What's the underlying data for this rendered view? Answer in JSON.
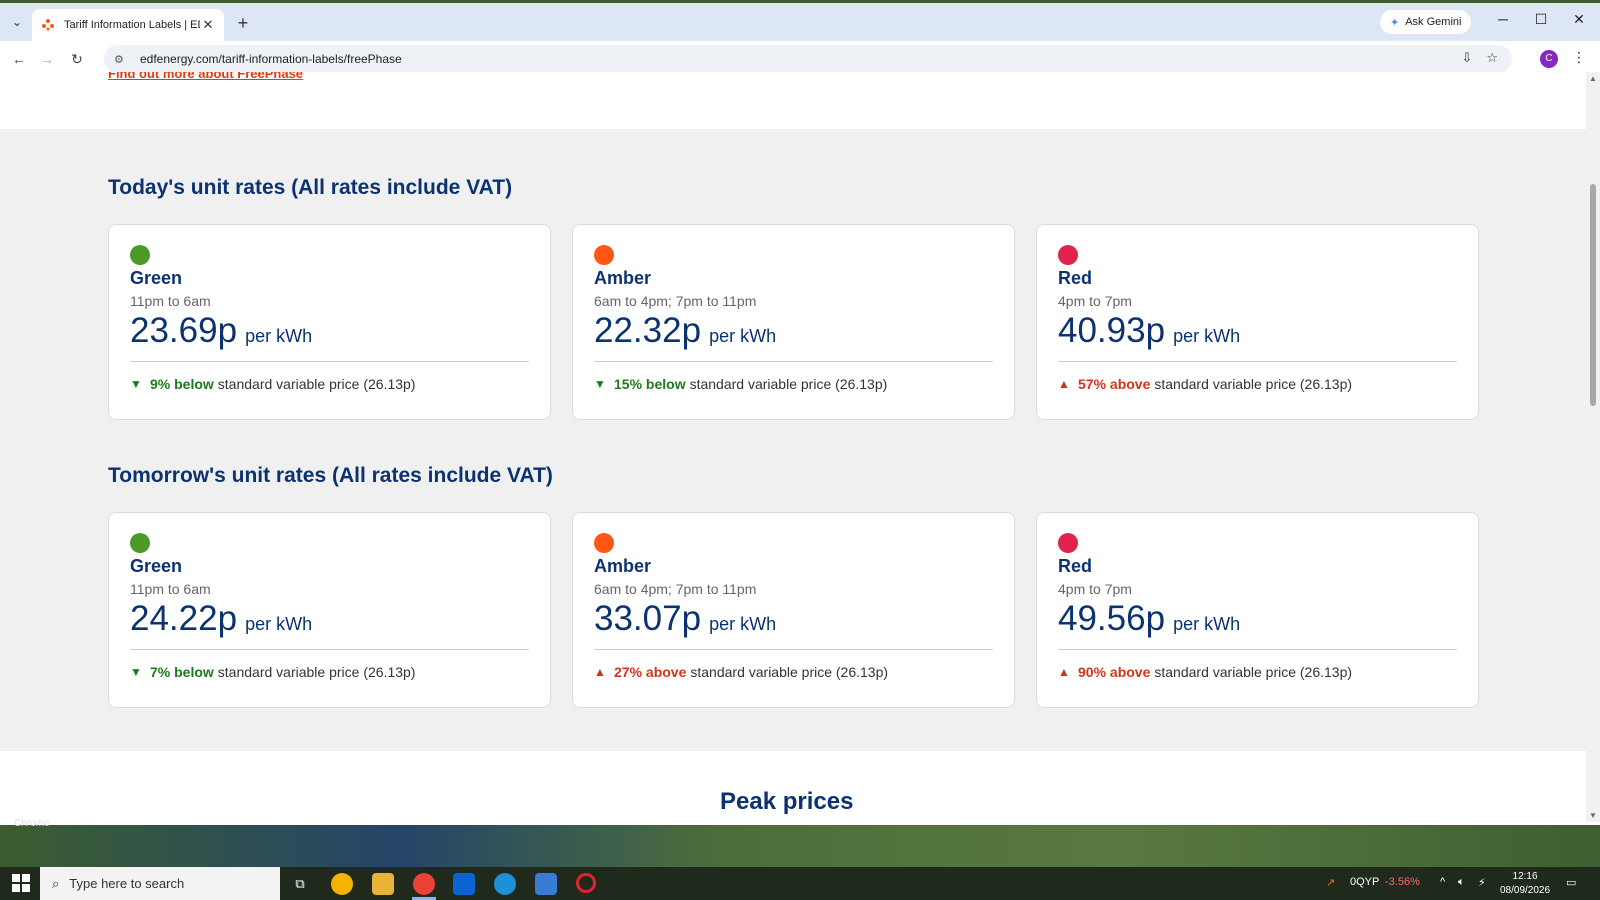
{
  "browser": {
    "tab_title": "Tariff Information Labels | EDF",
    "url": "edfenergy.com/tariff-information-labels/freePhase",
    "ask_gemini": "Ask Gemini",
    "avatar_letter": "C"
  },
  "page": {
    "find_more_link": "Find out more about FreePhase",
    "today_title": "Today's unit rates (All rates include VAT)",
    "tomorrow_title": "Tomorrow's unit rates (All rates include VAT)",
    "next_heading": "Peak prices",
    "per_kwh": "per kWh",
    "svp_text": "standard variable price (26.13p)",
    "today": [
      {
        "name": "Green",
        "time": "11pm to 6am",
        "price": "23.69p",
        "direction": "below",
        "arrow": "▼",
        "pct": "9% below",
        "color": "#4c9a2a"
      },
      {
        "name": "Amber",
        "time": "6am to 4pm; 7pm to 11pm",
        "price": "22.32p",
        "direction": "below",
        "arrow": "▼",
        "pct": "15% below",
        "color": "#fe5716"
      },
      {
        "name": "Red",
        "time": "4pm to 7pm",
        "price": "40.93p",
        "direction": "above",
        "arrow": "▲",
        "pct": "57% above",
        "color": "#e0234e"
      }
    ],
    "tomorrow": [
      {
        "name": "Green",
        "time": "11pm to 6am",
        "price": "24.22p",
        "direction": "below",
        "arrow": "▼",
        "pct": "7% below",
        "color": "#4c9a2a"
      },
      {
        "name": "Amber",
        "time": "6am to 4pm; 7pm to 11pm",
        "price": "33.07p",
        "direction": "above",
        "arrow": "▲",
        "pct": "27% above",
        "color": "#fe5716"
      },
      {
        "name": "Red",
        "time": "4pm to 7pm",
        "price": "49.56p",
        "direction": "above",
        "arrow": "▲",
        "pct": "90% above",
        "color": "#e0234e"
      }
    ]
  },
  "taskbar": {
    "search_placeholder": "Type here to search",
    "chrome_label": "Chrome",
    "stock_ticker": "0QYP",
    "stock_change": "-3.56%",
    "time": "12:16",
    "date": "08/09/2026"
  }
}
